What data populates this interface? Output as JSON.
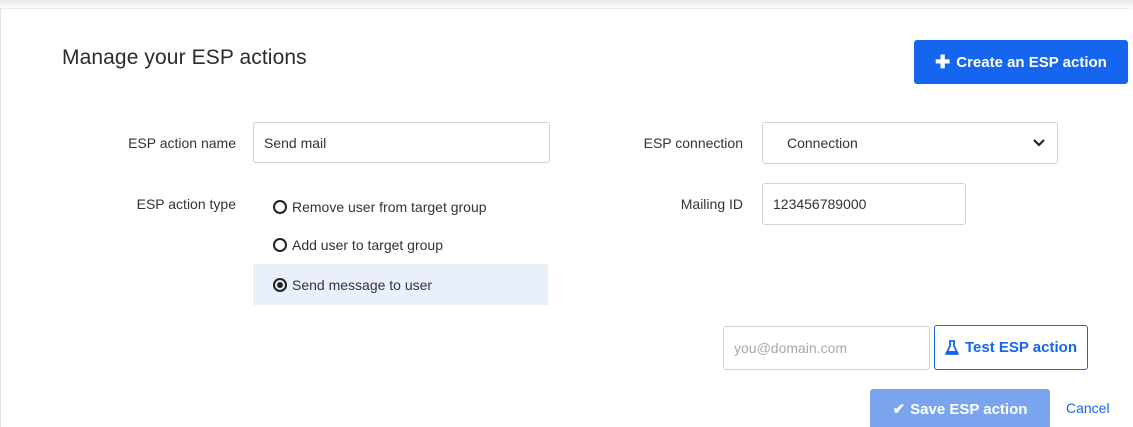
{
  "header": {
    "title": "Manage your ESP actions",
    "create_button_icon": "plus-icon",
    "create_button_label": "Create an ESP action"
  },
  "form": {
    "name_label": "ESP action name",
    "name_value": "Send mail",
    "type_label": "ESP action type",
    "type_options": [
      {
        "label": "Remove user from target group",
        "selected": false
      },
      {
        "label": "Add user to target group",
        "selected": false
      },
      {
        "label": "Send message to user",
        "selected": true
      }
    ],
    "connection_label": "ESP connection",
    "connection_value": "Connection",
    "mailing_label": "Mailing ID",
    "mailing_value": "123456789000"
  },
  "test": {
    "email_placeholder": "you@domain.com",
    "test_button_icon": "flask-icon",
    "test_button_label": "Test ESP action"
  },
  "footer": {
    "save_button_icon": "check-icon",
    "save_button_label": "Save ESP action",
    "cancel_label": "Cancel"
  },
  "colors": {
    "primary": "#1565ee",
    "primary_disabled": "#7aa5ee",
    "selected_row": "#eaf0fb"
  }
}
